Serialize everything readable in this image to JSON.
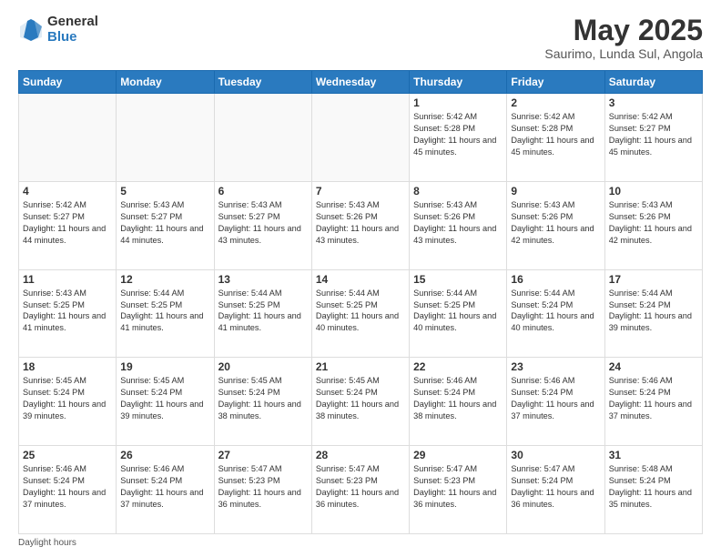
{
  "header": {
    "logo_general": "General",
    "logo_blue": "Blue",
    "title": "May 2025",
    "subtitle": "Saurimo, Lunda Sul, Angola"
  },
  "weekdays": [
    "Sunday",
    "Monday",
    "Tuesday",
    "Wednesday",
    "Thursday",
    "Friday",
    "Saturday"
  ],
  "weeks": [
    [
      {
        "day": "",
        "info": ""
      },
      {
        "day": "",
        "info": ""
      },
      {
        "day": "",
        "info": ""
      },
      {
        "day": "",
        "info": ""
      },
      {
        "day": "1",
        "info": "Sunrise: 5:42 AM\nSunset: 5:28 PM\nDaylight: 11 hours and 45 minutes."
      },
      {
        "day": "2",
        "info": "Sunrise: 5:42 AM\nSunset: 5:28 PM\nDaylight: 11 hours and 45 minutes."
      },
      {
        "day": "3",
        "info": "Sunrise: 5:42 AM\nSunset: 5:27 PM\nDaylight: 11 hours and 45 minutes."
      }
    ],
    [
      {
        "day": "4",
        "info": "Sunrise: 5:42 AM\nSunset: 5:27 PM\nDaylight: 11 hours and 44 minutes."
      },
      {
        "day": "5",
        "info": "Sunrise: 5:43 AM\nSunset: 5:27 PM\nDaylight: 11 hours and 44 minutes."
      },
      {
        "day": "6",
        "info": "Sunrise: 5:43 AM\nSunset: 5:27 PM\nDaylight: 11 hours and 43 minutes."
      },
      {
        "day": "7",
        "info": "Sunrise: 5:43 AM\nSunset: 5:26 PM\nDaylight: 11 hours and 43 minutes."
      },
      {
        "day": "8",
        "info": "Sunrise: 5:43 AM\nSunset: 5:26 PM\nDaylight: 11 hours and 43 minutes."
      },
      {
        "day": "9",
        "info": "Sunrise: 5:43 AM\nSunset: 5:26 PM\nDaylight: 11 hours and 42 minutes."
      },
      {
        "day": "10",
        "info": "Sunrise: 5:43 AM\nSunset: 5:26 PM\nDaylight: 11 hours and 42 minutes."
      }
    ],
    [
      {
        "day": "11",
        "info": "Sunrise: 5:43 AM\nSunset: 5:25 PM\nDaylight: 11 hours and 41 minutes."
      },
      {
        "day": "12",
        "info": "Sunrise: 5:44 AM\nSunset: 5:25 PM\nDaylight: 11 hours and 41 minutes."
      },
      {
        "day": "13",
        "info": "Sunrise: 5:44 AM\nSunset: 5:25 PM\nDaylight: 11 hours and 41 minutes."
      },
      {
        "day": "14",
        "info": "Sunrise: 5:44 AM\nSunset: 5:25 PM\nDaylight: 11 hours and 40 minutes."
      },
      {
        "day": "15",
        "info": "Sunrise: 5:44 AM\nSunset: 5:25 PM\nDaylight: 11 hours and 40 minutes."
      },
      {
        "day": "16",
        "info": "Sunrise: 5:44 AM\nSunset: 5:24 PM\nDaylight: 11 hours and 40 minutes."
      },
      {
        "day": "17",
        "info": "Sunrise: 5:44 AM\nSunset: 5:24 PM\nDaylight: 11 hours and 39 minutes."
      }
    ],
    [
      {
        "day": "18",
        "info": "Sunrise: 5:45 AM\nSunset: 5:24 PM\nDaylight: 11 hours and 39 minutes."
      },
      {
        "day": "19",
        "info": "Sunrise: 5:45 AM\nSunset: 5:24 PM\nDaylight: 11 hours and 39 minutes."
      },
      {
        "day": "20",
        "info": "Sunrise: 5:45 AM\nSunset: 5:24 PM\nDaylight: 11 hours and 38 minutes."
      },
      {
        "day": "21",
        "info": "Sunrise: 5:45 AM\nSunset: 5:24 PM\nDaylight: 11 hours and 38 minutes."
      },
      {
        "day": "22",
        "info": "Sunrise: 5:46 AM\nSunset: 5:24 PM\nDaylight: 11 hours and 38 minutes."
      },
      {
        "day": "23",
        "info": "Sunrise: 5:46 AM\nSunset: 5:24 PM\nDaylight: 11 hours and 37 minutes."
      },
      {
        "day": "24",
        "info": "Sunrise: 5:46 AM\nSunset: 5:24 PM\nDaylight: 11 hours and 37 minutes."
      }
    ],
    [
      {
        "day": "25",
        "info": "Sunrise: 5:46 AM\nSunset: 5:24 PM\nDaylight: 11 hours and 37 minutes."
      },
      {
        "day": "26",
        "info": "Sunrise: 5:46 AM\nSunset: 5:24 PM\nDaylight: 11 hours and 37 minutes."
      },
      {
        "day": "27",
        "info": "Sunrise: 5:47 AM\nSunset: 5:23 PM\nDaylight: 11 hours and 36 minutes."
      },
      {
        "day": "28",
        "info": "Sunrise: 5:47 AM\nSunset: 5:23 PM\nDaylight: 11 hours and 36 minutes."
      },
      {
        "day": "29",
        "info": "Sunrise: 5:47 AM\nSunset: 5:23 PM\nDaylight: 11 hours and 36 minutes."
      },
      {
        "day": "30",
        "info": "Sunrise: 5:47 AM\nSunset: 5:24 PM\nDaylight: 11 hours and 36 minutes."
      },
      {
        "day": "31",
        "info": "Sunrise: 5:48 AM\nSunset: 5:24 PM\nDaylight: 11 hours and 35 minutes."
      }
    ]
  ],
  "footer": "Daylight hours"
}
